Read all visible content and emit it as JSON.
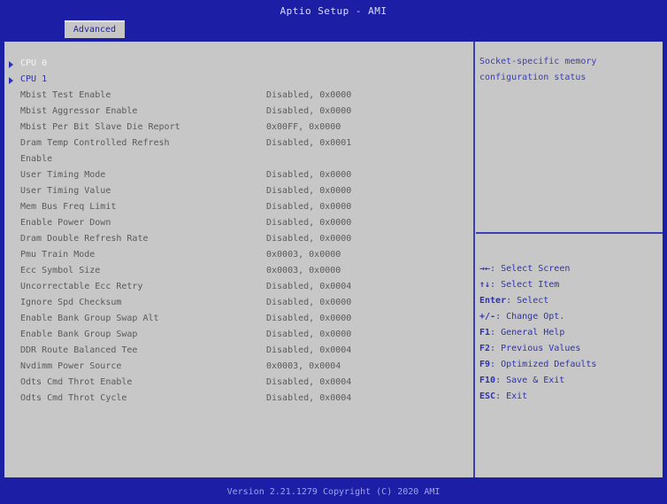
{
  "header": {
    "title": "Aptio Setup - AMI",
    "tab": "Advanced"
  },
  "menu": {
    "submenus": [
      {
        "label": "CPU 0",
        "selected": true
      },
      {
        "label": "CPU 1",
        "selected": false
      }
    ],
    "settings": [
      {
        "label": "Mbist Test Enable",
        "value": "Disabled, 0x0000"
      },
      {
        "label": "Mbist Aggressor Enable",
        "value": "Disabled, 0x0000"
      },
      {
        "label": "Mbist Per Bit Slave Die Report",
        "value": "0x00FF, 0x0000"
      },
      {
        "label": "Dram Temp Controlled Refresh",
        "value": "Disabled, 0x0001"
      },
      {
        "label": "Enable",
        "value": ""
      },
      {
        "label": "User Timing Mode",
        "value": "Disabled, 0x0000"
      },
      {
        "label": "User Timing Value",
        "value": "Disabled, 0x0000"
      },
      {
        "label": "Mem Bus Freq Limit",
        "value": "Disabled, 0x0000"
      },
      {
        "label": "Enable Power Down",
        "value": "Disabled, 0x0000"
      },
      {
        "label": "Dram Double Refresh Rate",
        "value": "Disabled, 0x0000"
      },
      {
        "label": "Pmu Train Mode",
        "value": "0x0003, 0x0000"
      },
      {
        "label": "Ecc Symbol Size",
        "value": "0x0003, 0x0000"
      },
      {
        "label": "Uncorrectable Ecc Retry",
        "value": "Disabled, 0x0004"
      },
      {
        "label": "Ignore Spd Checksum",
        "value": "Disabled, 0x0000"
      },
      {
        "label": "Enable Bank Group Swap Alt",
        "value": "Disabled, 0x0000"
      },
      {
        "label": "Enable Bank Group Swap",
        "value": "Disabled, 0x0000"
      },
      {
        "label": "DDR Route Balanced Tee",
        "value": "Disabled, 0x0004"
      },
      {
        "label": "Nvdimm Power Source",
        "value": "0x0003, 0x0004"
      },
      {
        "label": "Odts Cmd Throt Enable",
        "value": "Disabled, 0x0004"
      },
      {
        "label": "Odts Cmd Throt Cycle",
        "value": "Disabled, 0x0004"
      }
    ]
  },
  "help": {
    "description": "Socket-specific memory configuration status"
  },
  "keys": [
    {
      "key": "→←",
      "action": ": Select Screen"
    },
    {
      "key": "↑↓",
      "action": ": Select Item"
    },
    {
      "key": "Enter",
      "action": ": Select"
    },
    {
      "key": "+/-",
      "action": ": Change Opt."
    },
    {
      "key": "F1",
      "action": ": General Help"
    },
    {
      "key": "F2",
      "action": ": Previous Values"
    },
    {
      "key": "F9",
      "action": ": Optimized Defaults"
    },
    {
      "key": "F10",
      "action": ": Save & Exit"
    },
    {
      "key": "ESC",
      "action": ": Exit"
    }
  ],
  "footer": {
    "version": "Version 2.21.1279 Copyright (C) 2020 AMI"
  }
}
